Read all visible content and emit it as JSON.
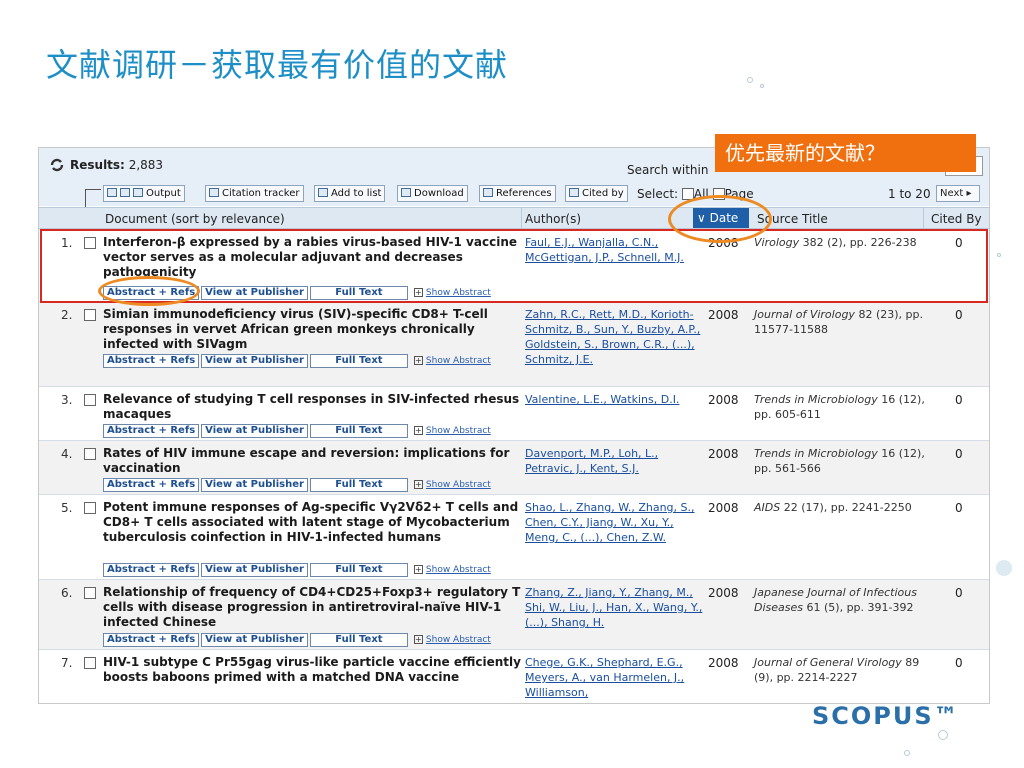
{
  "slide": {
    "title": "文献调研－获取最有价值的文献",
    "callout": "优先最新的文献？",
    "brand": "SCOPUS™"
  },
  "results": {
    "label": "Results:",
    "count": "2,883",
    "search_within": "Search within"
  },
  "toolbar": {
    "output": "Output",
    "citation_tracker": "Citation tracker",
    "add_to_list": "Add to list",
    "download": "Download",
    "references": "References",
    "cited_by": "Cited by",
    "select_label": "Select:",
    "all": "All",
    "page": "Page",
    "range": "1 to 20",
    "next": "Next"
  },
  "columns": {
    "document": "Document (sort by relevance)",
    "authors": "Author(s)",
    "date": "Date",
    "source": "Source Title",
    "cited": "Cited By"
  },
  "row_links": {
    "abstract": "Abstract + Refs",
    "publisher": "View at Publisher",
    "full_text": "Full Text",
    "show_abstract": "Show Abstract"
  },
  "rows": [
    {
      "num": "1.",
      "title": "Interferon-β expressed by a rabies virus-based HIV-1 vaccine vector serves as a molecular adjuvant and decreases pathogenicity",
      "authors": "Faul, E.J., Wanjalla, C.N., McGettigan, J.P., Schnell, M.J.",
      "date": "2008",
      "journal": "Virology",
      "source_detail": " 382 (2), pp. 226-238",
      "cited": "0"
    },
    {
      "num": "2.",
      "title": "Simian immunodeficiency virus (SIV)-specific CD8+ T-cell responses in vervet African green monkeys chronically infected with SIVagm",
      "authors": "Zahn, R.C., Rett, M.D., Korioth-Schmitz, B., Sun, Y., Buzby, A.P., Goldstein, S., Brown, C.R., (...), Schmitz, J.E.",
      "date": "2008",
      "journal": "Journal of Virology",
      "source_detail": " 82 (23), pp. 11577-11588",
      "cited": "0"
    },
    {
      "num": "3.",
      "title": "Relevance of studying T cell responses in SIV-infected rhesus macaques",
      "authors": "Valentine, L.E., Watkins, D.I.",
      "date": "2008",
      "journal": "Trends in Microbiology",
      "source_detail": " 16 (12), pp. 605-611",
      "cited": "0"
    },
    {
      "num": "4.",
      "title": "Rates of HIV immune escape and reversion: implications for vaccination",
      "authors": "Davenport, M.P., Loh, L., Petravic, J., Kent, S.J.",
      "date": "2008",
      "journal": "Trends in Microbiology",
      "source_detail": " 16 (12), pp. 561-566",
      "cited": "0"
    },
    {
      "num": "5.",
      "title": "Potent immune responses of Ag-specific Vγ2Vδ2+ T cells and CD8+ T cells associated with latent stage of Mycobacterium tuberculosis coinfection in HIV-1-infected humans",
      "authors": "Shao, L., Zhang, W., Zhang, S., Chen, C.Y., Jiang, W., Xu, Y., Meng, C., (...), Chen, Z.W.",
      "date": "2008",
      "journal": "AIDS",
      "source_detail": " 22 (17), pp. 2241-2250",
      "cited": "0"
    },
    {
      "num": "6.",
      "title": "Relationship of frequency of CD4+CD25+Foxp3+ regulatory T cells with disease progression in antiretroviral-naïve HIV-1 infected Chinese",
      "authors": "Zhang, Z., Jiang, Y., Zhang, M., Shi, W., Liu, J., Han, X., Wang, Y., (...), Shang, H.",
      "date": "2008",
      "journal": "Japanese Journal of Infectious Diseases",
      "source_detail": " 61 (5), pp. 391-392",
      "cited": "0"
    },
    {
      "num": "7.",
      "title": "HIV-1 subtype C Pr55gag virus-like particle vaccine efficiently boosts baboons primed with a matched DNA vaccine",
      "authors": "Chege, G.K., Shephard, E.G., Meyers, A., van Harmelen, J., Williamson,",
      "date": "2008",
      "journal": "Journal of General Virology",
      "source_detail": " 89 (9), pp. 2214-2227",
      "cited": "0"
    }
  ]
}
